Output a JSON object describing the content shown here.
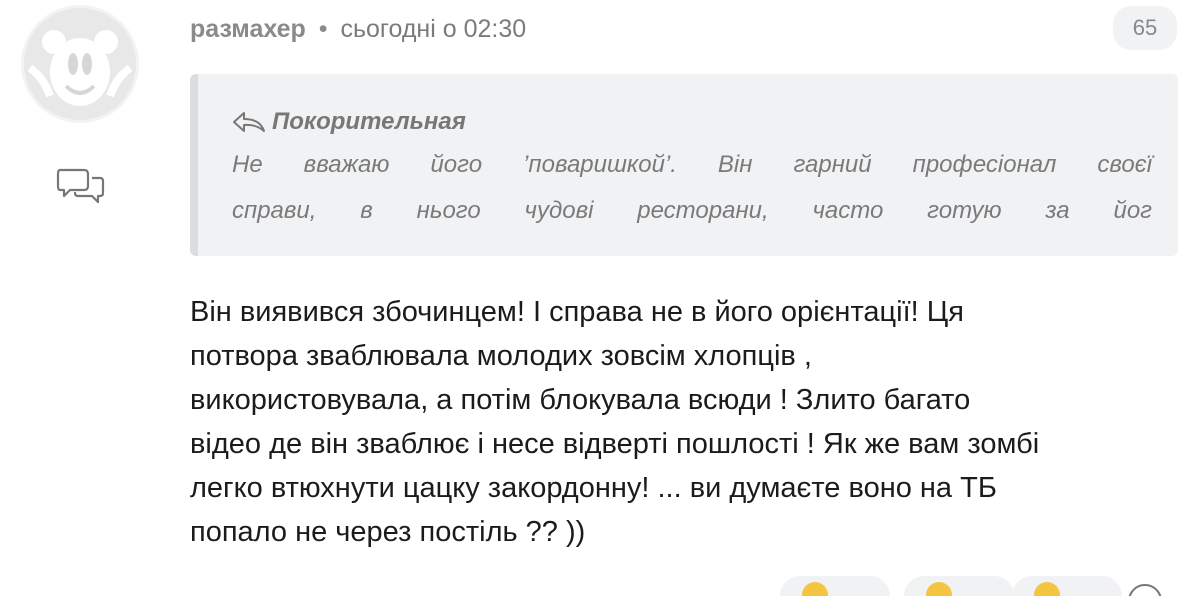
{
  "comment": {
    "author": "размахер",
    "separator": "•",
    "timestamp": "сьогодні о 02:30",
    "vote_count": "65",
    "quote": {
      "author": "Покорительная",
      "lines": [
        "Не вважаю його ’поваришкой’. Він гарний професіонал своєї",
        "справи, в нього чудові ресторани, часто готую за йог"
      ]
    },
    "body_lines": [
      "Він виявився збочинцем! І справа не в його орієнтації! Ця",
      "потвора зваблювала молодих зовсім хлопців ,",
      "використовувала, а потім блокувала всюди ! Злито багато",
      "відео де він зваблює і несе відверті пошлості ! Як же вам зомбі",
      "легко втюхнути цацку закордонну! ... ви думаєте воно на ТБ",
      "попало не через постіль ?? ))"
    ]
  },
  "icons": {
    "avatar": "default-avatar-icon",
    "reply": "reply-speech-bubbles-icon",
    "quote_back": "reply-arrow-icon",
    "reactions": [
      "reaction-emoji-icon",
      "reaction-emoji-icon",
      "reaction-emoji-icon",
      "add-reaction-icon"
    ]
  },
  "colors": {
    "meta_text": "#8a8a8a",
    "quote_bg": "#f1f2f4",
    "quote_border": "#dcdde0",
    "body_text": "#1b1b1b"
  }
}
